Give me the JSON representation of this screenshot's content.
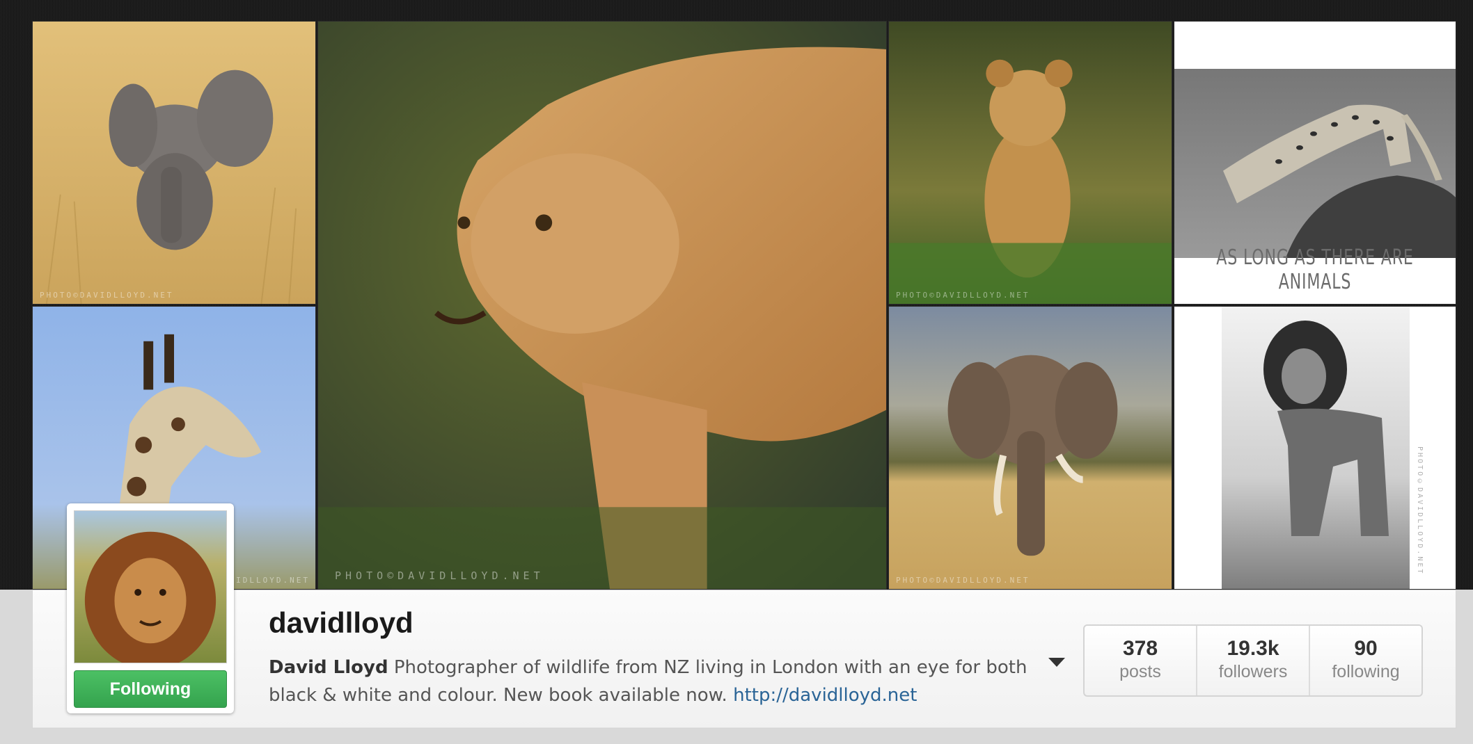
{
  "profile": {
    "username": "davidlloyd",
    "full_name": "David Lloyd",
    "bio": "Photographer of wildlife from NZ living in London with an eye for both black & white and colour. New book available now.",
    "website": "http://davidlloyd.net",
    "follow_button_label": "Following",
    "follow_button_color": "#3fb157"
  },
  "stats": [
    {
      "value": "378",
      "label": "posts"
    },
    {
      "value": "19.3k",
      "label": "followers"
    },
    {
      "value": "90",
      "label": "following"
    }
  ],
  "photos": [
    {
      "subject": "baby-elephant",
      "watermark": "PHOTO©DAVIDLLOYD.NET"
    },
    {
      "subject": "lioness",
      "watermark": "PHOTO©DAVIDLLOYD.NET"
    },
    {
      "subject": "lion-cub",
      "watermark": "PHOTO©DAVIDLLOYD.NET"
    },
    {
      "subject": "cheetah",
      "caption": "AS LONG AS THERE ARE ANIMALS"
    },
    {
      "subject": "giraffe",
      "watermark": "DAVIDLLOYD.NET"
    },
    {
      "subject": "elephant",
      "watermark": "PHOTO©DAVIDLLOYD.NET"
    },
    {
      "subject": "lion-bw",
      "watermark": "PHOTO©DAVIDLLOYD.NET"
    }
  ],
  "icons": {
    "bio_toggle": "caret-down-icon"
  }
}
